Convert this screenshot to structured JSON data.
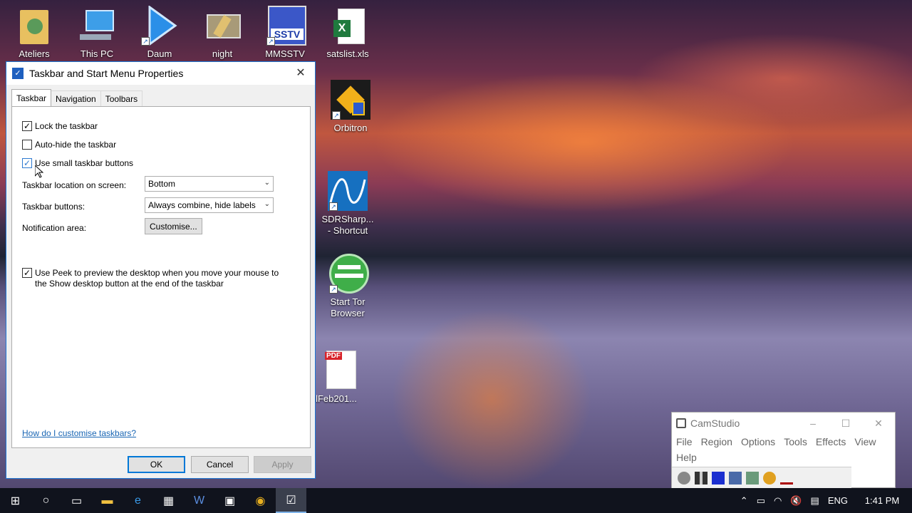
{
  "desktop": {
    "icons": [
      {
        "label": "Ateliers",
        "icon": "folder-user-icon"
      },
      {
        "label": "This PC",
        "icon": "computer-icon"
      },
      {
        "label": "Daum",
        "icon": "play-icon"
      },
      {
        "label": "night",
        "icon": "image-icon"
      },
      {
        "label": "MMSSTV",
        "icon": "sstv-icon"
      },
      {
        "label": "satslist.xls",
        "icon": "excel-icon"
      },
      {
        "label": "Orbitron",
        "icon": "orbitron-icon"
      },
      {
        "label": "SDRSharp...\n- Shortcut",
        "icon": "sdrsharp-icon"
      },
      {
        "label": "Start Tor\nBrowser",
        "icon": "tor-icon"
      },
      {
        "label": "lFeb201...",
        "icon": "pdf-icon"
      }
    ],
    "sstv_text": "SSTV",
    "pdf_text": "PDF"
  },
  "dialog": {
    "title": "Taskbar and Start Menu Properties",
    "close": "✕",
    "tabs": [
      "Taskbar",
      "Navigation",
      "Toolbars"
    ],
    "options": {
      "lock": {
        "label": "Lock the taskbar",
        "checked": true
      },
      "autohide": {
        "label": "Auto-hide the taskbar",
        "checked": false
      },
      "small": {
        "label": "Use small taskbar buttons",
        "checked": true
      },
      "peek": {
        "label": "Use Peek to preview the desktop when you move your mouse to the Show desktop button at the end of the taskbar",
        "checked": true
      }
    },
    "location_label": "Taskbar location on screen:",
    "location_value": "Bottom",
    "buttons_label": "Taskbar buttons:",
    "buttons_value": "Always combine, hide labels",
    "notification_label": "Notification area:",
    "customise_label": "Customise...",
    "help_link": "How do I customise taskbars?",
    "ok": "OK",
    "cancel": "Cancel",
    "apply": "Apply"
  },
  "camstudio": {
    "title": "CamStudio",
    "menu": [
      "File",
      "Region",
      "Options",
      "Tools",
      "Effects",
      "View",
      "Help"
    ]
  },
  "taskbar": {
    "lang": "ENG",
    "time": "1:41 PM"
  },
  "colors": {
    "accent": "#0078d7",
    "taskbar": "#10131d"
  }
}
